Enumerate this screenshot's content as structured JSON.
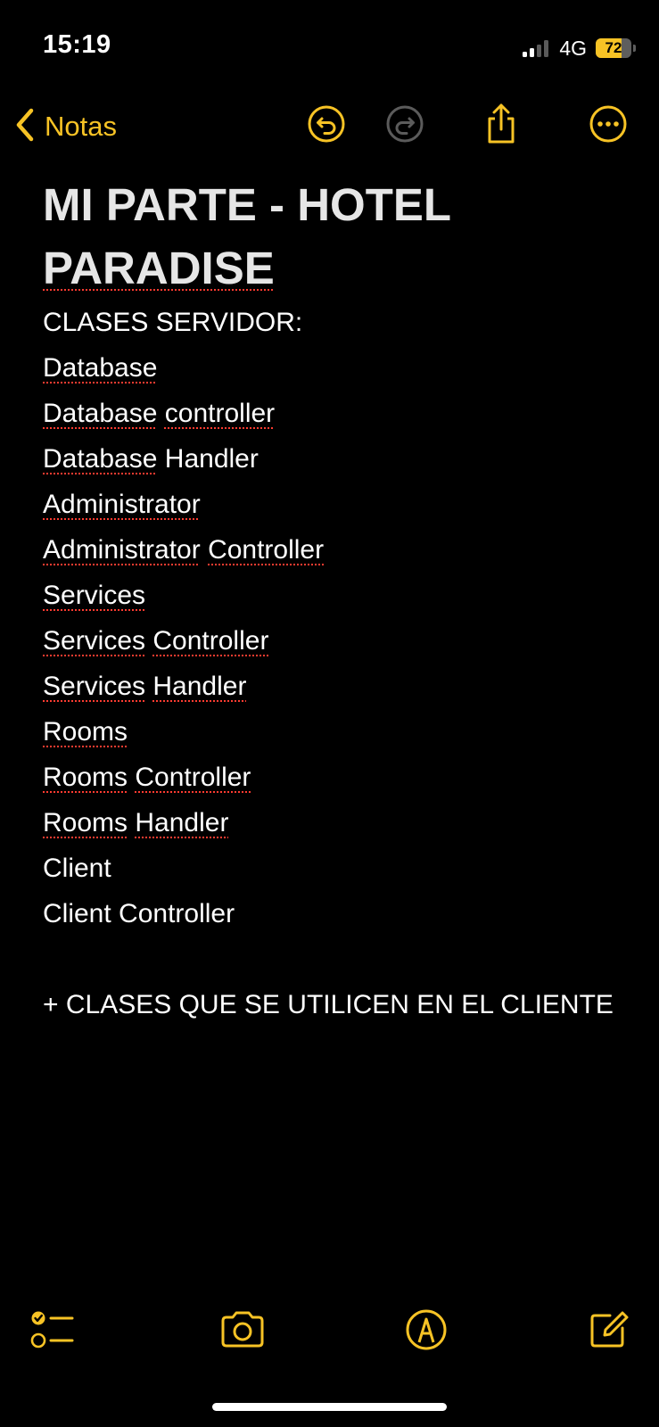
{
  "status_bar": {
    "time": "15:19",
    "network": "4G",
    "battery_level": "72",
    "battery_fraction": 0.72,
    "signal_bars_active": 2,
    "signal_bars_total": 4
  },
  "nav": {
    "back_label": "Notas",
    "icons": [
      "undo-icon",
      "redo-icon",
      "share-icon",
      "more-icon"
    ]
  },
  "note": {
    "title_line1": "MI PARTE - HOTEL",
    "title_line2": "PARADISE",
    "heading": "CLASES SERVIDOR:",
    "items": [
      [
        "Database"
      ],
      [
        "Database",
        "controller"
      ],
      [
        "Database",
        "Handler"
      ],
      [
        "Administrator"
      ],
      [
        "Administrator",
        "Controller"
      ],
      [
        "Services"
      ],
      [
        "Services",
        "Controller"
      ],
      [
        "Services",
        "Handler"
      ],
      [
        "Rooms"
      ],
      [
        "Rooms",
        "Controller"
      ],
      [
        "Rooms",
        "Handler"
      ],
      [
        "Client"
      ],
      [
        "Client",
        "Controller"
      ]
    ],
    "footer": "+ CLASES QUE SE UTILICEN EN EL CLIENTE"
  },
  "toolbar": {
    "icons": [
      "checklist-icon",
      "camera-icon",
      "markup-icon",
      "compose-icon"
    ]
  },
  "colors": {
    "accent": "#f7c325",
    "background": "#000000",
    "text": "#ffffff",
    "spellcheck": "#ff3b30",
    "disabled": "#5b5b5b"
  }
}
